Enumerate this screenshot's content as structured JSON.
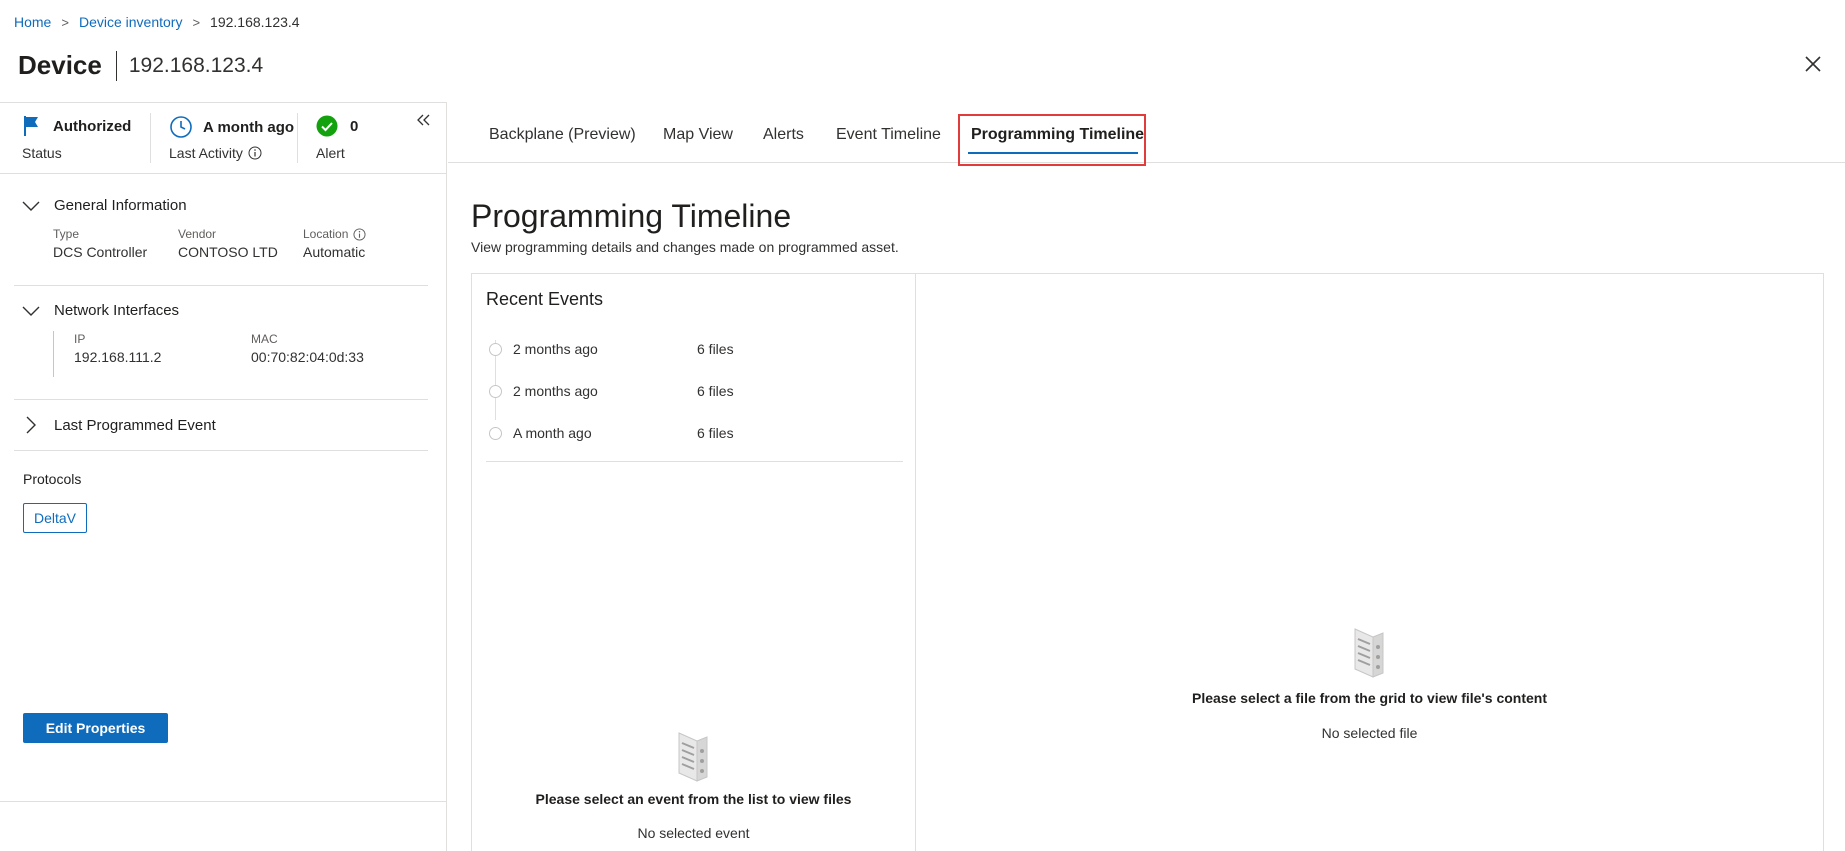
{
  "breadcrumb": {
    "home": "Home",
    "inventory": "Device inventory",
    "current": "192.168.123.4"
  },
  "header": {
    "title": "Device",
    "ip": "192.168.123.4"
  },
  "status": {
    "status_value": "Authorized",
    "status_label": "Status",
    "activity_value": "A month ago",
    "activity_label": "Last Activity",
    "alert_value": "0",
    "alert_label": "Alert"
  },
  "general": {
    "title": "General Information",
    "type_label": "Type",
    "type_value": "DCS Controller",
    "vendor_label": "Vendor",
    "vendor_value": "CONTOSO LTD",
    "location_label": "Location",
    "location_value": "Automatic"
  },
  "network": {
    "title": "Network Interfaces",
    "ip_label": "IP",
    "ip_value": "192.168.111.2",
    "mac_label": "MAC",
    "mac_value": "00:70:82:04:0d:33"
  },
  "last_programmed": {
    "title": "Last Programmed Event"
  },
  "protocols": {
    "label": "Protocols",
    "items": [
      "DeltaV"
    ]
  },
  "actions": {
    "edit_label": "Edit Properties"
  },
  "tabs": [
    {
      "label": "Backplane (Preview)"
    },
    {
      "label": "Map View"
    },
    {
      "label": "Alerts"
    },
    {
      "label": "Event Timeline"
    },
    {
      "label": "Programming Timeline",
      "active": true
    }
  ],
  "main": {
    "title": "Programming Timeline",
    "subtitle": "View programming details and changes made on programmed asset."
  },
  "recent": {
    "title": "Recent Events",
    "events": [
      {
        "when": "2 months ago",
        "files": "6 files"
      },
      {
        "when": "2 months ago",
        "files": "6 files"
      },
      {
        "when": "A month ago",
        "files": "6 files"
      }
    ],
    "empty_title": "Please select an event from the list to view files",
    "empty_sub": "No selected event"
  },
  "viewer": {
    "empty_title": "Please select a file from the grid to view file's content",
    "empty_sub": "No selected file"
  },
  "colors": {
    "accent": "#0f6cbd",
    "success": "#13a10e",
    "highlight": "#e03c3c"
  }
}
